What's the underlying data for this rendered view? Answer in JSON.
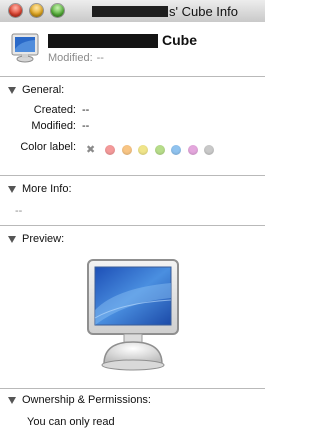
{
  "window": {
    "title_suffix": "s' Cube Info"
  },
  "header": {
    "name_suffix": "Cube",
    "modified_label": "Modified:",
    "modified_value": "--"
  },
  "general": {
    "heading": "General:",
    "created_label": "Created:",
    "created_value": "--",
    "modified_label": "Modified:",
    "modified_value": "--",
    "color_label": "Color label:",
    "color_none_symbol": "✖",
    "colors": [
      "#f49a9a",
      "#f8c584",
      "#f0e58a",
      "#b7dd8a",
      "#90c3ef",
      "#e4a7dd",
      "#c9c9c9"
    ]
  },
  "more_info": {
    "heading": "More Info:",
    "value": "--"
  },
  "preview": {
    "heading": "Preview:"
  },
  "ownership": {
    "heading": "Ownership & Permissions:",
    "text": "You can only read"
  }
}
